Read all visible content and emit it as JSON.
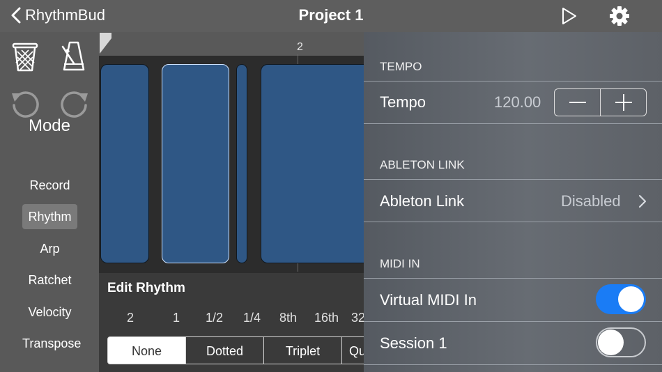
{
  "header": {
    "back_label": "RhythmBud",
    "title": "Project 1"
  },
  "ruler": {
    "marker": "2"
  },
  "sidebar": {
    "mode_title": "Mode",
    "modes": [
      "Record",
      "Rhythm",
      "Arp",
      "Ratchet",
      "Velocity",
      "Transpose"
    ],
    "active_mode": "Rhythm"
  },
  "edit_rhythm": {
    "title": "Edit Rhythm",
    "durations": [
      "2",
      "1",
      "1/2",
      "1/4",
      "8th",
      "16th",
      "32"
    ],
    "modifiers": [
      "None",
      "Dotted",
      "Triplet",
      "Qu"
    ],
    "active_modifier": "None"
  },
  "settings": {
    "tempo_header": "TEMPO",
    "tempo_label": "Tempo",
    "tempo_value": "120.00",
    "link_header": "ABLETON LINK",
    "link_label": "Ableton Link",
    "link_value": "Disabled",
    "midi_header": "MIDI IN",
    "virtual_midi_label": "Virtual MIDI In",
    "virtual_midi_on": true,
    "session_label": "Session 1",
    "session_on": false
  },
  "colors": {
    "accent": "#1a7cf5",
    "note_fill": "#2f5785"
  }
}
